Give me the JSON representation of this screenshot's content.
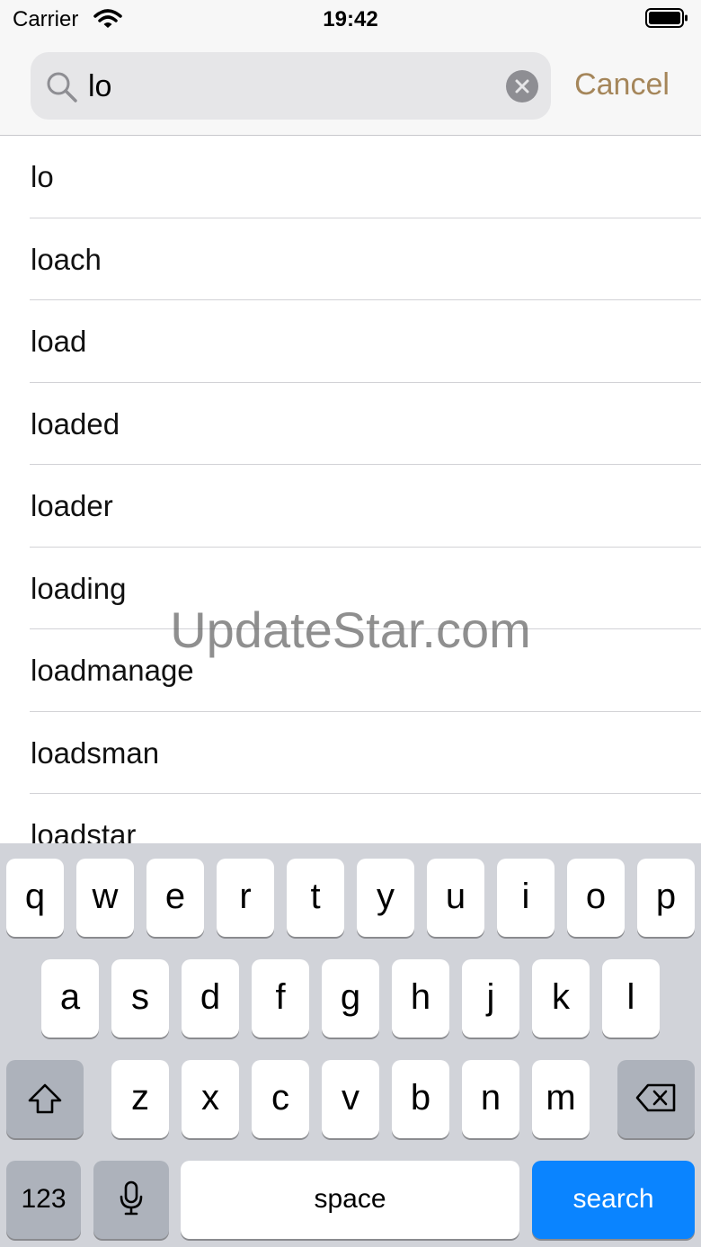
{
  "status_bar": {
    "carrier": "Carrier",
    "time": "19:42"
  },
  "search": {
    "query": "lo",
    "cancel_label": "Cancel"
  },
  "results": [
    "lo",
    "loach",
    "load",
    "loaded",
    "loader",
    "loading",
    "loadmanage",
    "loadsman",
    "loadstar"
  ],
  "watermark": "UpdateStar.com",
  "keyboard": {
    "row1": [
      "q",
      "w",
      "e",
      "r",
      "t",
      "y",
      "u",
      "i",
      "o",
      "p"
    ],
    "row2": [
      "a",
      "s",
      "d",
      "f",
      "g",
      "h",
      "j",
      "k",
      "l"
    ],
    "row3": [
      "z",
      "x",
      "c",
      "v",
      "b",
      "n",
      "m"
    ],
    "numbers_label": "123",
    "space_label": "space",
    "search_label": "search"
  },
  "colors": {
    "accent": "#a5865a",
    "keyboard_action": "#0a84ff"
  }
}
